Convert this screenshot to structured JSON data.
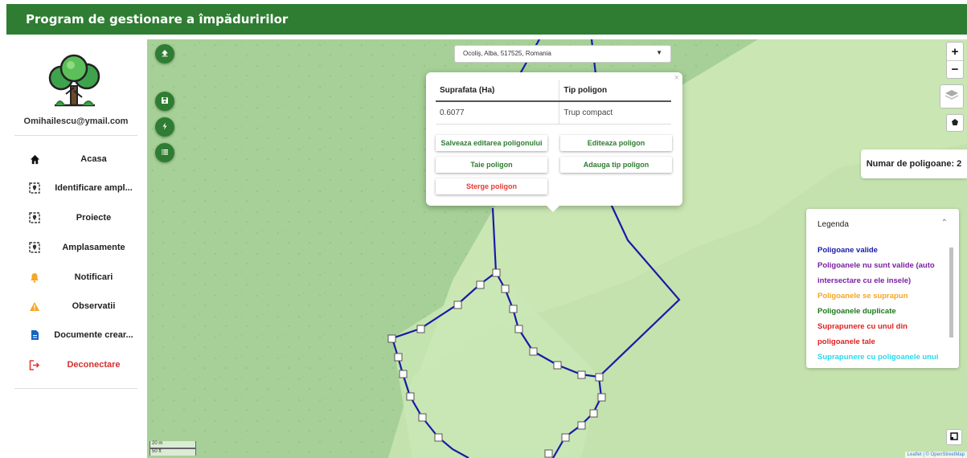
{
  "header": {
    "title": "Program de gestionare a împăduririlor"
  },
  "sidebar": {
    "email": "Omihailescu@ymail.com",
    "items": [
      {
        "label": "Acasa",
        "icon": "home-icon"
      },
      {
        "label": "Identificare ampl...",
        "icon": "location-frame-icon"
      },
      {
        "label": "Proiecte",
        "icon": "location-frame-icon"
      },
      {
        "label": "Amplasamente",
        "icon": "location-frame-icon"
      },
      {
        "label": "Notificari",
        "icon": "bell-icon"
      },
      {
        "label": "Observatii",
        "icon": "warning-icon"
      },
      {
        "label": "Documente crear...",
        "icon": "document-icon"
      },
      {
        "label": "Deconectare",
        "icon": "logout-icon"
      }
    ]
  },
  "map": {
    "location": "Ocoliş, Alba, 517525, Romania",
    "fab_icons": [
      "upload-icon",
      "save-icon",
      "flash-icon",
      "list-icon"
    ],
    "zoom_in": "+",
    "zoom_out": "−",
    "scale_m": "20 m",
    "scale_ft": "50 ft",
    "attribution": "Leaflet | © OpenStreetMap"
  },
  "popup": {
    "headers": [
      "Suprafata (Ha)",
      "Tip poligon"
    ],
    "row": [
      "0.6077",
      "Trup compact"
    ],
    "close": "×",
    "buttons": {
      "save_edit": "Salveaza editarea poligonului",
      "edit": "Editeaza poligon",
      "cut": "Taie poligon",
      "add_type": "Adauga tip poligon",
      "delete": "Sterge poligon"
    }
  },
  "counter": {
    "text": "Numar de poligoane: 2"
  },
  "legend": {
    "title": "Legenda",
    "items": [
      {
        "text": "Poligoane valide",
        "color": "#1a1aa8"
      },
      {
        "text": "Poligoanele nu sunt valide (auto intersectare cu ele insele)",
        "color": "#7b1fa2"
      },
      {
        "text": "Poligoanele se suprapun",
        "color": "#f5a623"
      },
      {
        "text": "Poligoanele duplicate",
        "color": "#1b7a1b"
      },
      {
        "text": "Suprapunere cu unul din poligoanele tale",
        "color": "#e01f1f"
      },
      {
        "text": "Suprapunere cu poligoanele unui alt utilizator",
        "color": "#29d8f0"
      }
    ]
  },
  "colors": {
    "brand_green": "#2e7d32",
    "forest": "#a9d29b",
    "meadow": "#c9e6b3",
    "polygon_line": "#1a1aa8"
  }
}
